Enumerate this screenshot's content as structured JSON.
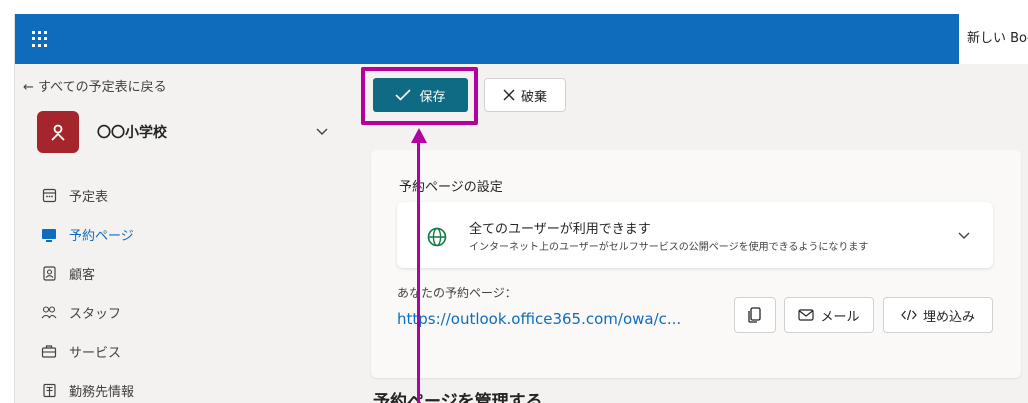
{
  "topbar": {
    "app_tab_title": "新しい Boo"
  },
  "sidebar": {
    "back_label": "← すべての予定表に戻る",
    "calendar": {
      "avatar_letter": "ጸ",
      "name": "〇〇小学校"
    },
    "items": [
      {
        "label": "予定表",
        "icon": "calendar-icon"
      },
      {
        "label": "予約ページ",
        "icon": "booking-page-icon",
        "active": true
      },
      {
        "label": "顧客",
        "icon": "customers-icon"
      },
      {
        "label": "スタッフ",
        "icon": "staff-icon"
      },
      {
        "label": "サービス",
        "icon": "services-icon"
      },
      {
        "label": "勤務先情報",
        "icon": "business-info-icon"
      }
    ]
  },
  "toolbar": {
    "save_label": "保存",
    "discard_label": "破棄"
  },
  "settings": {
    "title": "予約ページの設定",
    "access_title": "全てのユーザーが利用できます",
    "access_desc": "インターネット上のユーザーがセルフサービスの公開ページを使用できるようになります",
    "mypage_label": "あなたの予約ページ：",
    "url": "https://outlook.office365.com/owa/c...",
    "mail_label": "メール",
    "embed_label": "埋め込み"
  },
  "section_heading": "予約ページを管理する",
  "colors": {
    "accent": "#0f6cbd",
    "save_button": "#0f6b84",
    "highlight": "#b4009e"
  }
}
